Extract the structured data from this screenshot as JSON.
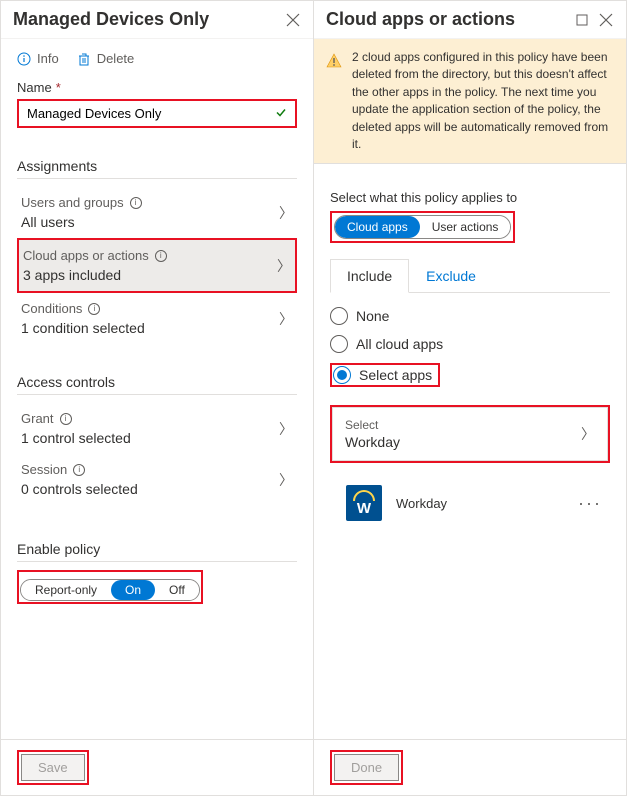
{
  "leftPanel": {
    "title": "Managed Devices Only",
    "toolbar": {
      "info": "Info",
      "delete": "Delete"
    },
    "nameLabel": "Name",
    "nameValue": "Managed Devices Only",
    "assignmentsTitle": "Assignments",
    "usersGroups": {
      "label": "Users and groups",
      "value": "All users"
    },
    "cloudApps": {
      "label": "Cloud apps or actions",
      "value": "3 apps included"
    },
    "conditions": {
      "label": "Conditions",
      "value": "1 condition selected"
    },
    "accessTitle": "Access controls",
    "grant": {
      "label": "Grant",
      "value": "1 control selected"
    },
    "session": {
      "label": "Session",
      "value": "0 controls selected"
    },
    "enableLabel": "Enable policy",
    "enableOptions": {
      "reportOnly": "Report-only",
      "on": "On",
      "off": "Off"
    },
    "save": "Save"
  },
  "rightPanel": {
    "title": "Cloud apps or actions",
    "warning": "2 cloud apps configured in this policy have been deleted from the directory, but this doesn't affect the other apps in the policy. The next time you update the application section of the policy, the deleted apps will be automatically removed from it.",
    "appliesLabel": "Select what this policy applies to",
    "toggle": {
      "cloudApps": "Cloud apps",
      "userActions": "User actions"
    },
    "tabs": {
      "include": "Include",
      "exclude": "Exclude"
    },
    "radios": {
      "none": "None",
      "all": "All cloud apps",
      "select": "Select apps"
    },
    "selectLabel": "Select",
    "selectValue": "Workday",
    "appName": "Workday",
    "done": "Done"
  }
}
